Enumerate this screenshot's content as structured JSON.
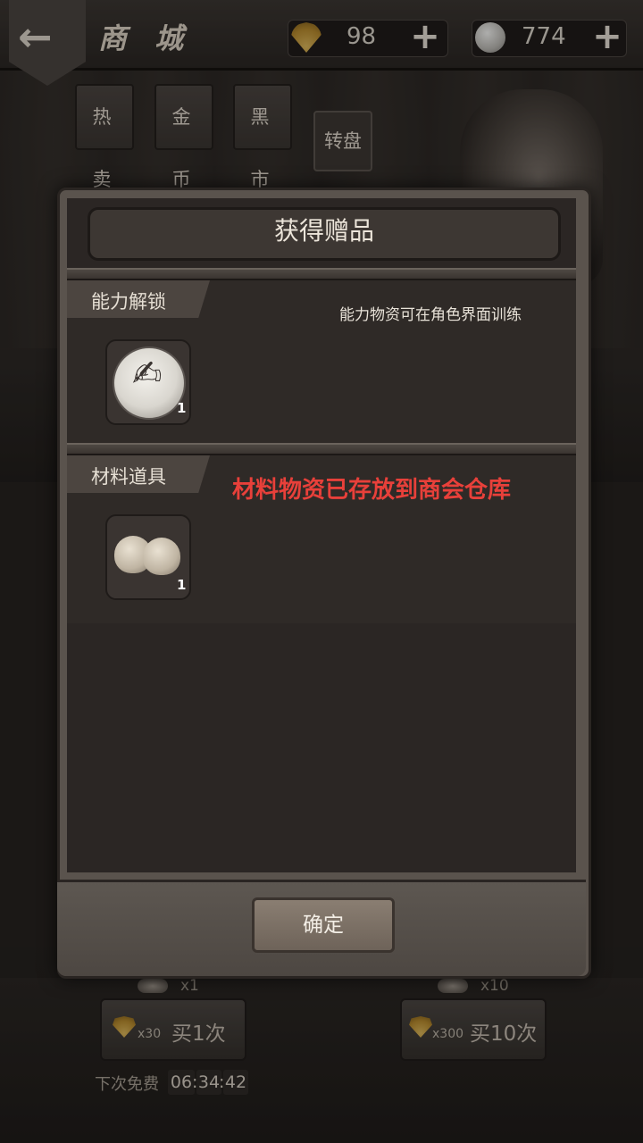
{
  "header": {
    "title": "商 城",
    "back_icon": "back-arrow-icon",
    "currencies": [
      {
        "name": "shell",
        "icon": "shell-icon",
        "value": "98"
      },
      {
        "name": "coin",
        "icon": "silver-coin-icon",
        "value": "774"
      }
    ]
  },
  "tabs": [
    {
      "label": "热 卖"
    },
    {
      "label": "金 币"
    },
    {
      "label": "黑 市"
    },
    {
      "label": "转盘"
    }
  ],
  "dialog": {
    "title": "获得赠品",
    "sections": [
      {
        "label": "能力解锁",
        "note": "能力物资可在角色界面训练",
        "items": [
          {
            "icon": "hand-pen-icon",
            "count": "1"
          }
        ]
      },
      {
        "label": "材料道具",
        "note": "材料物资已存放到商会仓库",
        "note_color": "#e8403a",
        "items": [
          {
            "icon": "garlic-icon",
            "count": "1"
          }
        ]
      }
    ],
    "confirm_label": "确定"
  },
  "wheel": {
    "single": {
      "qty": "x1",
      "cost": "x30",
      "label": "买1次"
    },
    "ten": {
      "qty": "x10",
      "cost": "x300",
      "label": "买10次"
    },
    "free_label": "下次免费",
    "timer": {
      "h": "06",
      "m": "34",
      "s": "42"
    }
  }
}
